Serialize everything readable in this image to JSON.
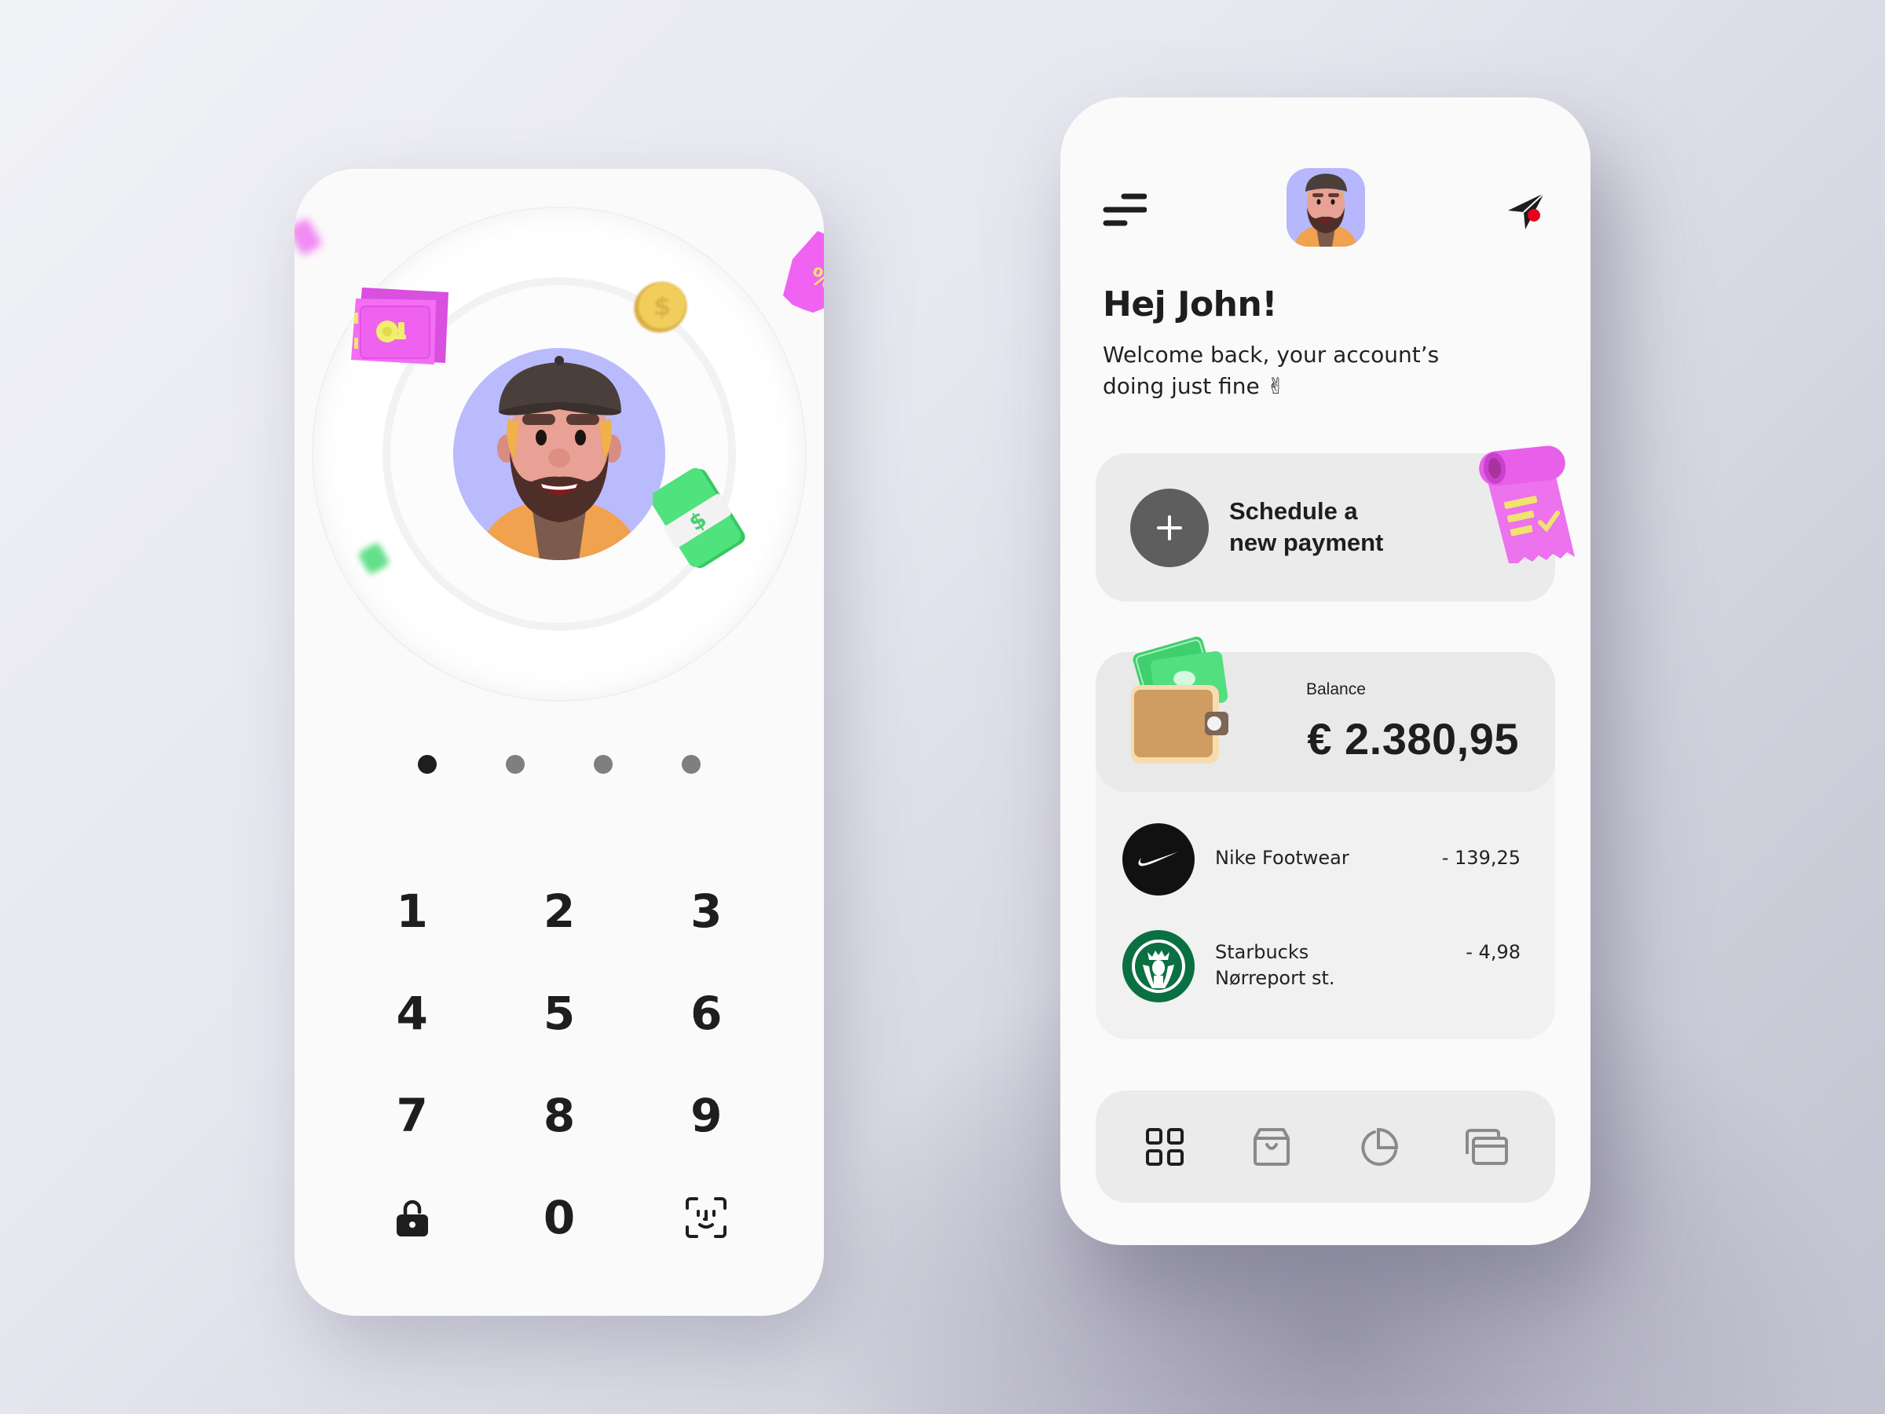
{
  "colors": {
    "text_primary": "#1e1e1e",
    "avatar_bg": "#babbfd",
    "card_bg": "#ebebeb",
    "plus_button": "#5e5e5e",
    "notification_dot": "#e8001c",
    "nav_active": "#1e1e1e",
    "nav_inactive": "#8a8a8a",
    "accent_pink": "#ee6ef0",
    "accent_green": "#4ddc78",
    "starbucks_green": "#0a7042"
  },
  "lock_screen": {
    "pin": {
      "length": 4,
      "entered": 1
    },
    "keypad": {
      "keys": [
        "1",
        "2",
        "3",
        "4",
        "5",
        "6",
        "7",
        "8",
        "9"
      ],
      "zero": "0",
      "left_action_icon": "unlock-icon",
      "right_action_icon": "face-id-icon"
    },
    "illustration": {
      "items": [
        "safe",
        "coin",
        "coupon",
        "cash-stack",
        "cash-blurred",
        "ticket-blurred"
      ],
      "coupon_symbol": "%",
      "cash_symbol": "$"
    }
  },
  "home_screen": {
    "header": {
      "menu_icon": "menu-icon",
      "avatar": "user-avatar",
      "send_icon": "send-icon",
      "has_notification": true
    },
    "greeting": "Hej John!",
    "welcome": "Welcome back, your account’s doing just fine ✌",
    "schedule": {
      "label_line1": "Schedule a",
      "label_line2": "new payment"
    },
    "balance": {
      "label": "Balance",
      "value": "€ 2.380,95"
    },
    "transactions": [
      {
        "merchant": "Nike Footwear",
        "merchant_line2": "",
        "amount": "- 139,25",
        "logo": "nike-logo"
      },
      {
        "merchant": "Starbucks",
        "merchant_line2": "Nørreport st.",
        "amount": "- 4,98",
        "logo": "starbucks-logo"
      }
    ],
    "nav": [
      {
        "id": "dashboard",
        "icon": "grid-icon",
        "active": true
      },
      {
        "id": "shopping",
        "icon": "shopping-bag-icon",
        "active": false
      },
      {
        "id": "statistics",
        "icon": "pie-chart-icon",
        "active": false
      },
      {
        "id": "cards",
        "icon": "cards-icon",
        "active": false
      }
    ]
  }
}
